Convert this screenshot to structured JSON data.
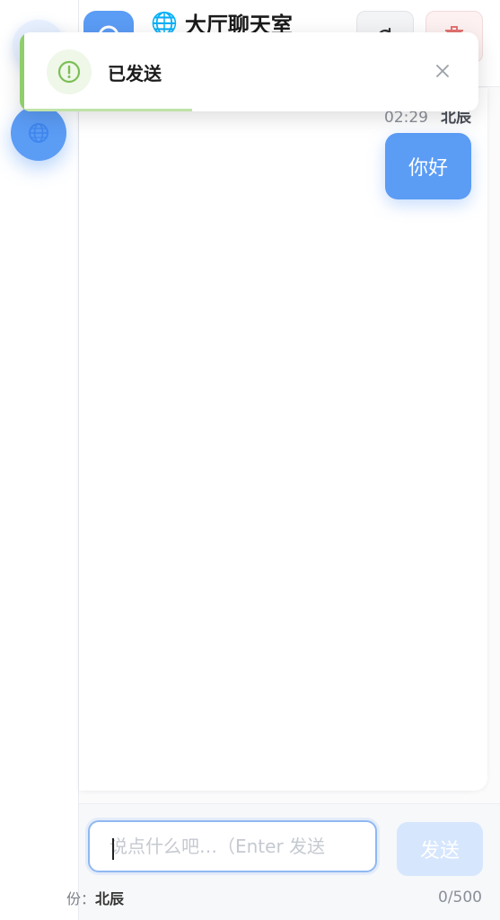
{
  "header": {
    "title": "大厅聊天室",
    "globe_emoji": "🌐"
  },
  "toast": {
    "message": "已发送",
    "progress": 0.37,
    "accent_color": "#8fce6a"
  },
  "messages": [
    {
      "time": "02:29",
      "sender": "北辰",
      "text": "你好"
    }
  ],
  "composer": {
    "placeholder": "说点什么吧…（Enter 发送",
    "value": "",
    "send_label": "发送",
    "identity_prefix": "份：",
    "identity_name": "北辰",
    "char_count": "0/500"
  },
  "colors": {
    "brand": "#5b9cf5",
    "success": "#8fce6a",
    "danger": "#e57373"
  }
}
